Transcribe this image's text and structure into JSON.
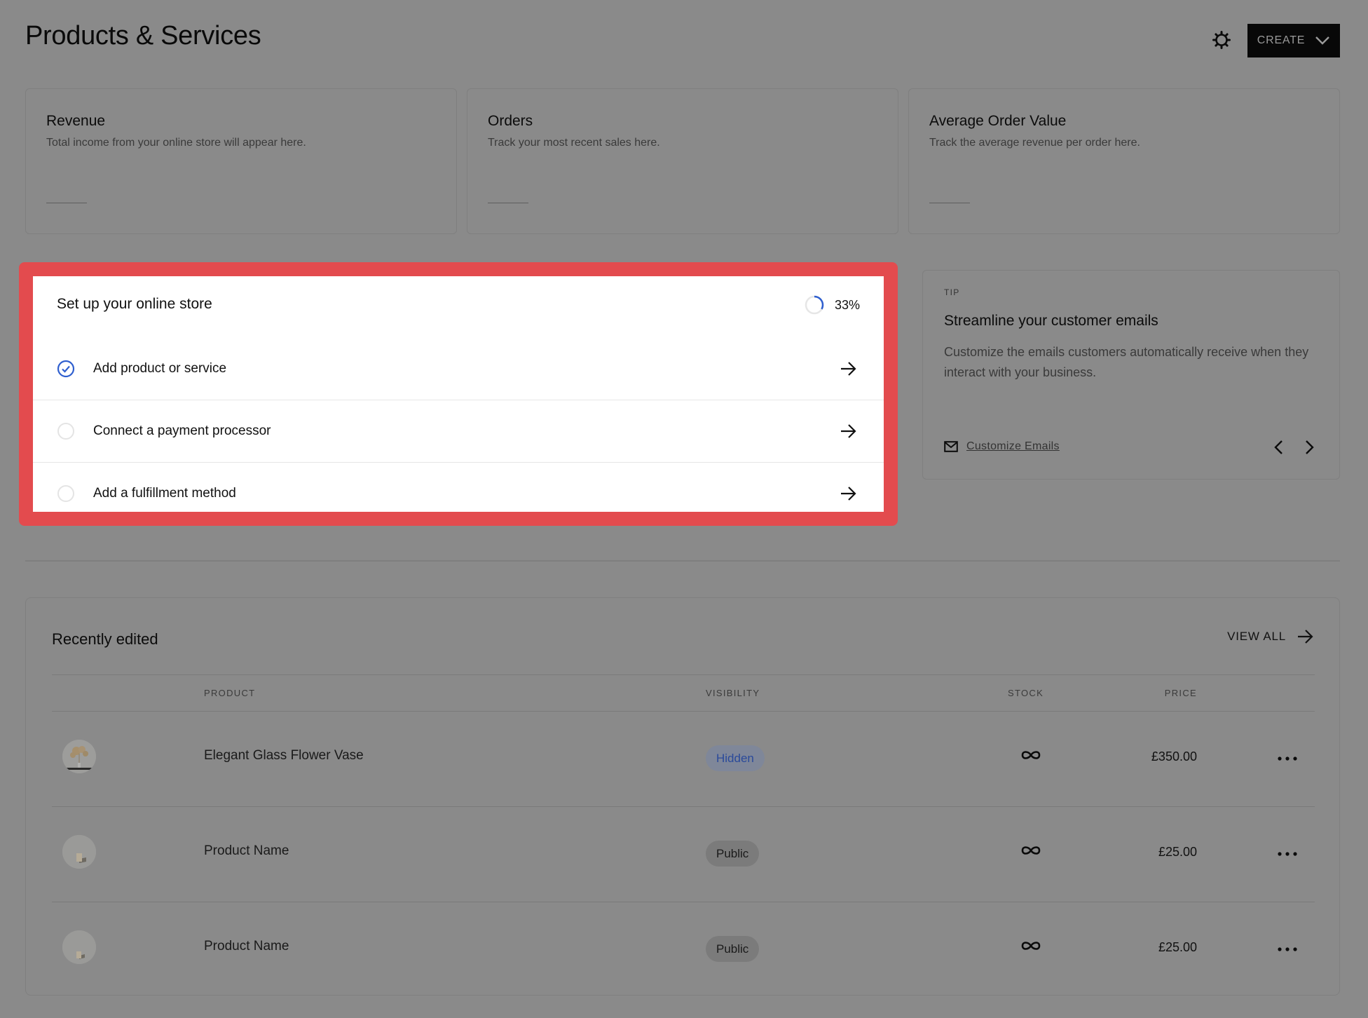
{
  "header": {
    "title": "Products & Services",
    "settings_icon": "gear-icon",
    "create_label": "CREATE",
    "create_icon": "chevron-down-icon"
  },
  "metrics": [
    {
      "title": "Revenue",
      "description": "Total income from your online store will appear here."
    },
    {
      "title": "Orders",
      "description": "Track your most recent sales here."
    },
    {
      "title": "Average Order Value",
      "description": "Track the average revenue per order here."
    }
  ],
  "setup": {
    "title": "Set up your online store",
    "progress_label": "33%",
    "progress_fraction": 0.33,
    "items": [
      {
        "label": "Add product or service",
        "completed": true
      },
      {
        "label": "Connect a payment processor",
        "completed": false
      },
      {
        "label": "Add a fulfillment method",
        "completed": false
      }
    ],
    "highlight_color": "#e34b4e",
    "accent_color": "#2f5fcf"
  },
  "tip": {
    "label": "TIP",
    "title": "Streamline your customer emails",
    "body": "Customize the emails customers automatically receive when they interact with your business.",
    "link_label": "Customize Emails",
    "link_icon": "mail-icon"
  },
  "recent": {
    "title": "Recently edited",
    "view_all_label": "VIEW ALL",
    "columns": {
      "product": "PRODUCT",
      "visibility": "VISIBILITY",
      "stock": "STOCK",
      "price": "PRICE"
    },
    "rows": [
      {
        "name": "Elegant Glass Flower Vase",
        "visibility": "Hidden",
        "stock": "∞",
        "price": "£350.00",
        "thumb": "vase"
      },
      {
        "name": "Product Name",
        "visibility": "Public",
        "stock": "∞",
        "price": "£25.00",
        "thumb": "box"
      },
      {
        "name": "Product Name",
        "visibility": "Public",
        "stock": "∞",
        "price": "£25.00",
        "thumb": "box"
      }
    ]
  }
}
